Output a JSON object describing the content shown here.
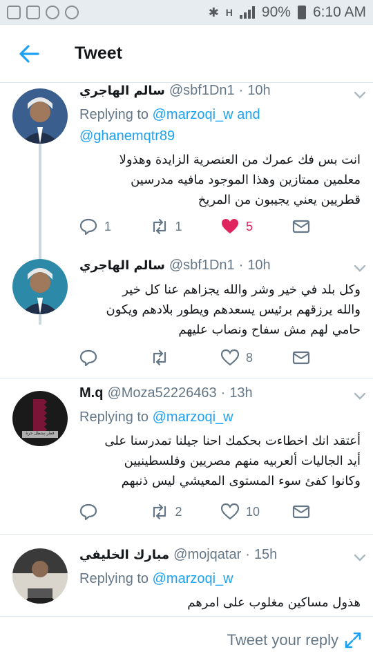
{
  "status_bar": {
    "battery": "90%",
    "time": "6:10 AM",
    "network": "H"
  },
  "header": {
    "title": "Tweet"
  },
  "tweets": [
    {
      "name": "سالم الهاجري",
      "handle": "@sbf1Dn1",
      "time": "10h",
      "reply_prefix": "Replying to",
      "reply_mentions": [
        "@marzoqi_w",
        "@ghanemqtr89"
      ],
      "reply_joiner": "and",
      "text_lines": [
        "انت بس فك عمرك من العنصرية الزايدة وهذولا",
        "معلمين ممتازين وهذا الموجود مافيه مدرسين",
        "قطريين يعني يجيبون من المريخ"
      ],
      "replies": "1",
      "retweets": "1",
      "likes": "5",
      "liked": true
    },
    {
      "name": "سالم الهاجري",
      "handle": "@sbf1Dn1",
      "time": "10h",
      "text_lines": [
        "وكل بلد في خير وشر والله يجزاهم عنا كل خير",
        "والله يرزقهم برئيس يسعدهم ويطور بلادهم ويكون",
        "حامي لهم مش سفاح ونصاب عليهم"
      ],
      "replies": "",
      "retweets": "",
      "likes": "8"
    },
    {
      "name": "M.q",
      "handle": "@Moza52226463",
      "time": "13h",
      "reply_prefix": "Replying to",
      "reply_mentions": [
        "@marzoqi_w"
      ],
      "text_lines": [
        "أعتقد انك اخطاءت بحكمك احنا جيلنا تمدرسنا على",
        "أيد الجاليات ألعربيه منهم مصريين وفلسطينيين",
        "وكانوا كفئ   سوء المستوى المعيشي ليس ذنبهم"
      ],
      "avatar_caption": "قطر ستظل حرة",
      "replies": "",
      "retweets": "2",
      "likes": "10"
    },
    {
      "name": "مبارك الخليفي",
      "handle": "@mojqatar",
      "time": "15h",
      "reply_prefix": "Replying to",
      "reply_mentions": [
        "@marzoqi_w"
      ],
      "text_lines": [
        "هذول مساكين مغلوب على امرهم"
      ]
    }
  ],
  "reply_bar": {
    "placeholder": "Tweet your reply"
  },
  "colors": {
    "accent": "#1da1f2",
    "like": "#e0245e",
    "muted": "#657786",
    "status_bg": "#e6ecf0"
  },
  "icons": [
    "back-arrow-icon",
    "chevron-down-icon",
    "reply-icon",
    "retweet-icon",
    "heart-icon",
    "dm-icon",
    "expand-icon"
  ]
}
